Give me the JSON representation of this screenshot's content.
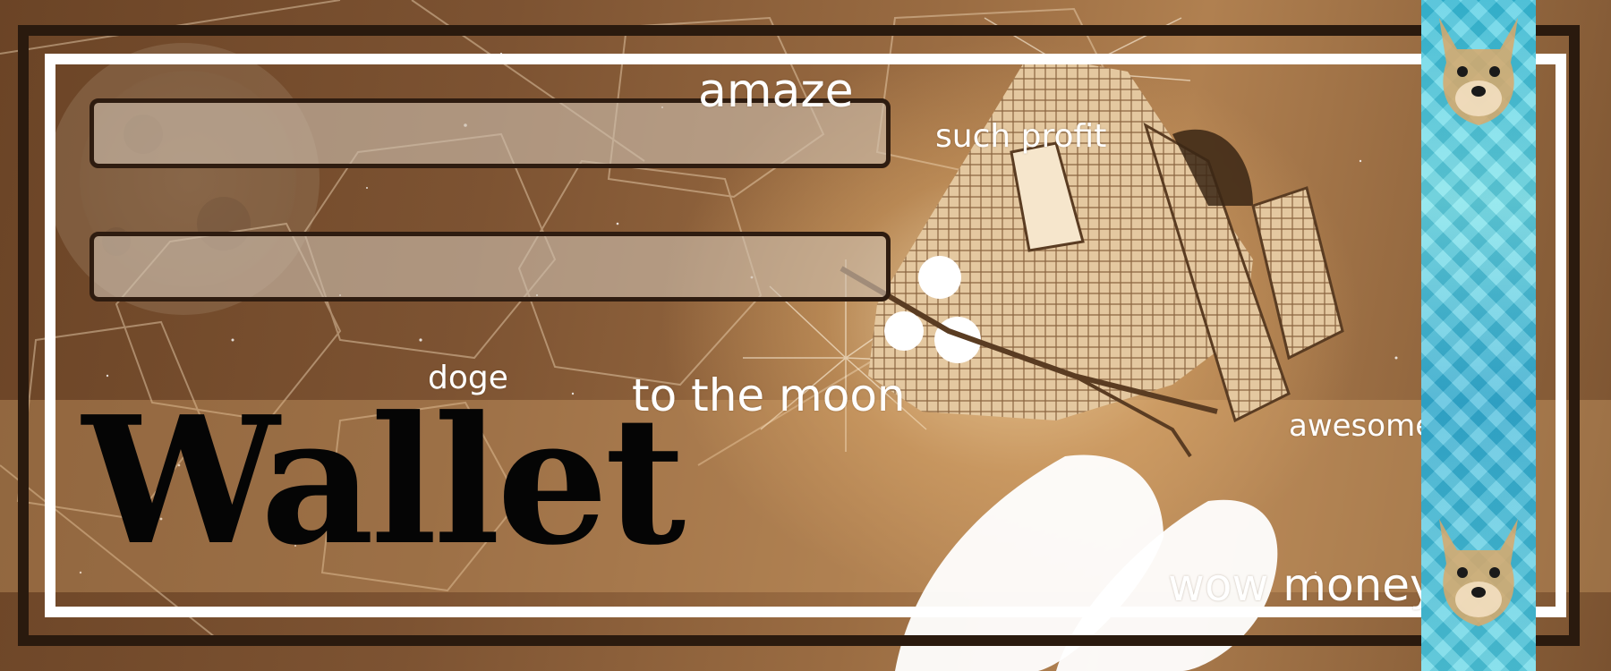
{
  "fields": {
    "field_1": {
      "value": "",
      "placeholder": ""
    },
    "field_2": {
      "value": "",
      "placeholder": ""
    }
  },
  "doge_words": {
    "amaze": "amaze",
    "such_profit": "such profit",
    "doge": "doge",
    "to_the_moon": "to the moon",
    "awesome": "awesome",
    "wow_money": "wow money"
  },
  "title": "Wallet",
  "colors": {
    "sepia_dark": "#2a1a0e",
    "frame_white": "#ffffff",
    "strip_cyan": "#3fc8e0",
    "title_black": "#050505"
  },
  "icons": {
    "moon": "moon-icon",
    "shuttle": "space-shuttle-icon",
    "doge": "doge-dog-icon"
  }
}
